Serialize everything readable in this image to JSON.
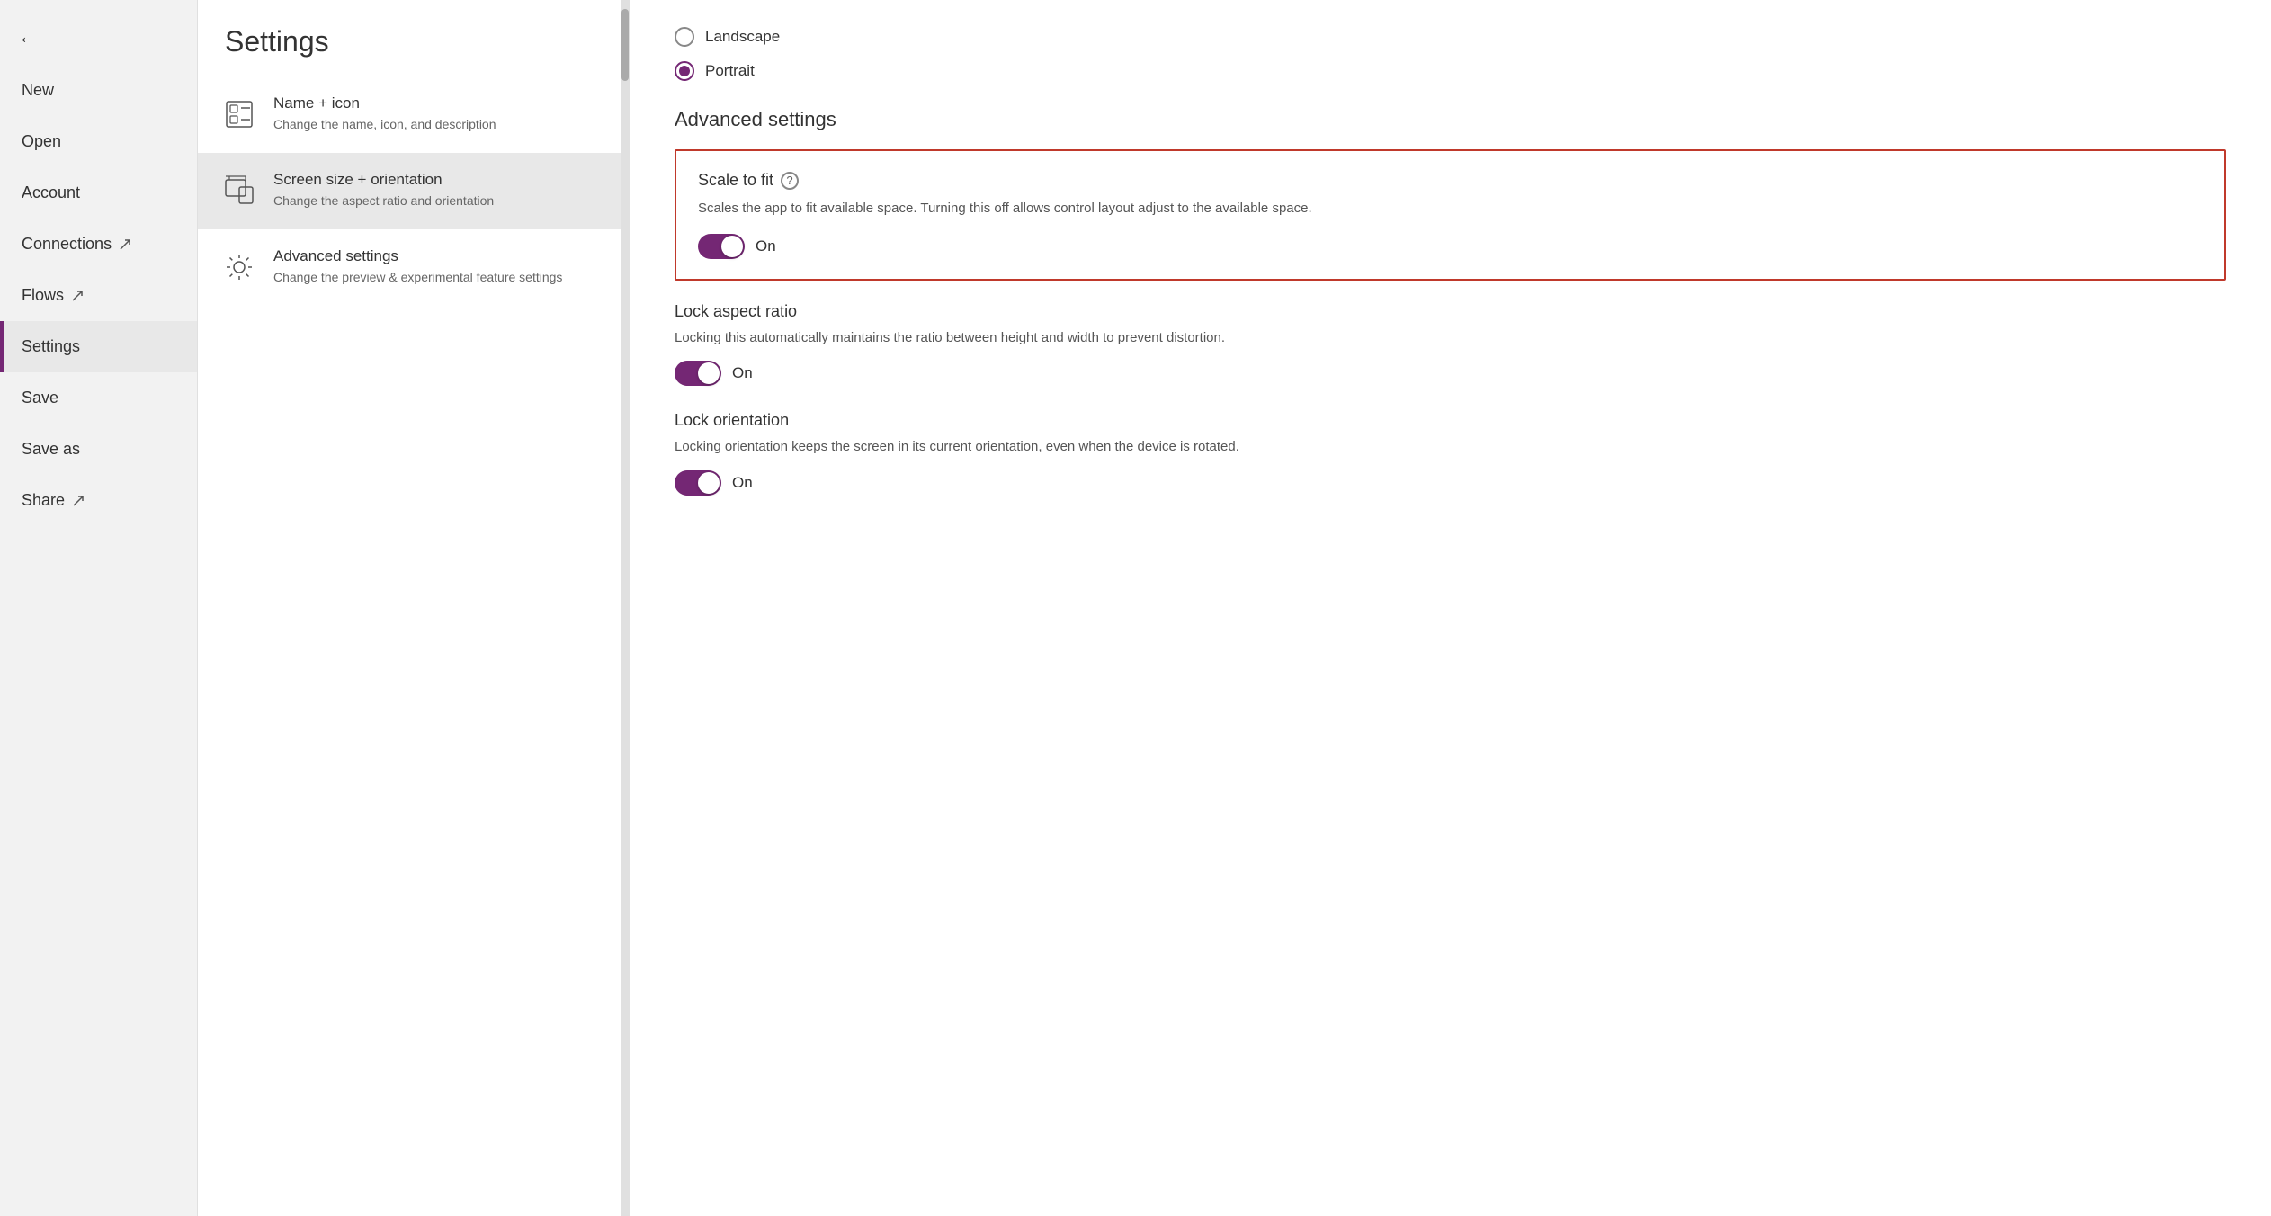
{
  "sidebar": {
    "back_label": "←",
    "items": [
      {
        "id": "new",
        "label": "New",
        "external": false,
        "active": false
      },
      {
        "id": "open",
        "label": "Open",
        "external": false,
        "active": false
      },
      {
        "id": "account",
        "label": "Account",
        "external": false,
        "active": false
      },
      {
        "id": "connections",
        "label": "Connections",
        "external": true,
        "active": false
      },
      {
        "id": "flows",
        "label": "Flows",
        "external": true,
        "active": false
      },
      {
        "id": "settings",
        "label": "Settings",
        "external": false,
        "active": true
      },
      {
        "id": "save",
        "label": "Save",
        "external": false,
        "active": false
      },
      {
        "id": "save-as",
        "label": "Save as",
        "external": false,
        "active": false
      },
      {
        "id": "share",
        "label": "Share",
        "external": true,
        "active": false
      }
    ]
  },
  "middle_panel": {
    "title": "Settings",
    "items": [
      {
        "id": "name-icon",
        "title": "Name + icon",
        "desc": "Change the name, icon, and description",
        "active": false
      },
      {
        "id": "screen-size",
        "title": "Screen size + orientation",
        "desc": "Change the aspect ratio and orientation",
        "active": true
      },
      {
        "id": "advanced-settings",
        "title": "Advanced settings",
        "desc": "Change the preview & experimental feature settings",
        "active": false
      }
    ]
  },
  "content": {
    "orientation": {
      "landscape_label": "Landscape",
      "portrait_label": "Portrait",
      "landscape_selected": false,
      "portrait_selected": true
    },
    "advanced_settings_heading": "Advanced settings",
    "scale_to_fit": {
      "title": "Scale to fit",
      "desc": "Scales the app to fit available space. Turning this off allows control layout adjust to the available space.",
      "toggle_label": "On",
      "enabled": true
    },
    "lock_aspect_ratio": {
      "title": "Lock aspect ratio",
      "desc": "Locking this automatically maintains the ratio between height and width to prevent distortion.",
      "toggle_label": "On",
      "enabled": true
    },
    "lock_orientation": {
      "title": "Lock orientation",
      "desc": "Locking orientation keeps the screen in its current orientation, even when the device is rotated.",
      "toggle_label": "On",
      "enabled": true
    }
  },
  "colors": {
    "accent": "#742774",
    "active_border": "#c0392b"
  }
}
